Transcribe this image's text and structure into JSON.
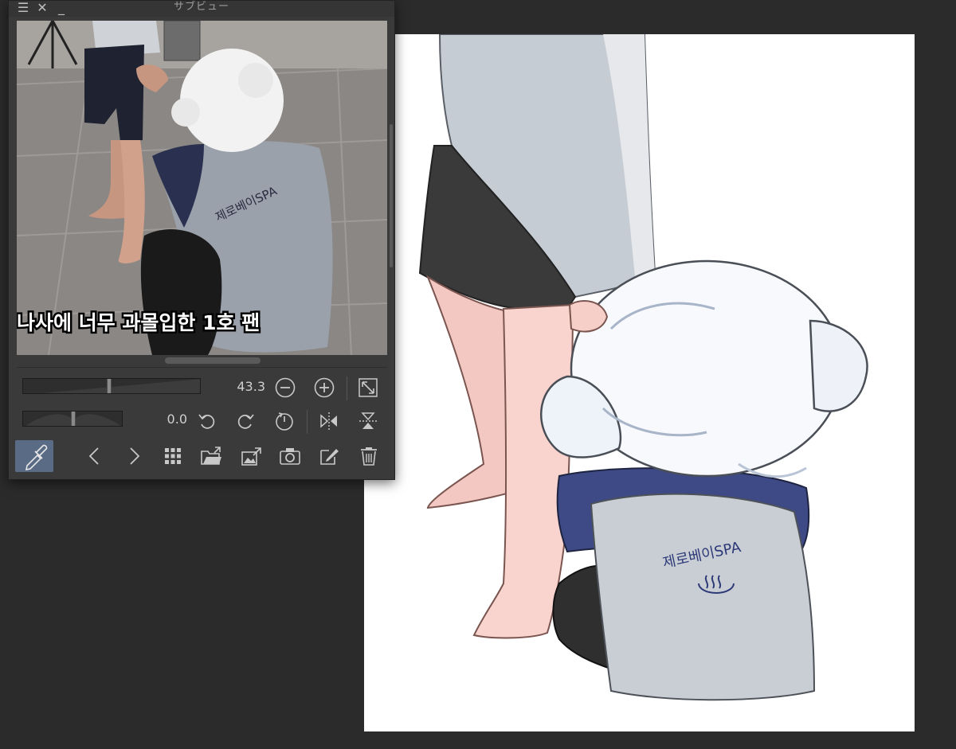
{
  "window": {
    "title": "サブビュー",
    "icons": [
      "menu-icon",
      "close-icon",
      "minimize-icon"
    ]
  },
  "subview": {
    "reference_caption": "나사에 너무 과몰입한 1호 팬",
    "shirt_text": "제로베이SPA"
  },
  "controls": {
    "zoom_value": "43.3",
    "zoom_level_fraction": 0.48,
    "rotation_value": "0.0",
    "rotation_level_fraction": 0.5
  },
  "toolbar": {
    "buttons": [
      "eyedropper-icon",
      "previous-icon",
      "next-icon",
      "grid-icon",
      "open-folder-icon",
      "import-icon",
      "camera-icon",
      "edit-icon",
      "trash-icon"
    ]
  },
  "artwork": {
    "shirt_text": "제로베이SPA"
  },
  "colors": {
    "panel_bg": "#3a3a3a",
    "app_bg": "#2b2b2b",
    "active_tool": "#5a6c85",
    "canvas": "#ffffff"
  }
}
